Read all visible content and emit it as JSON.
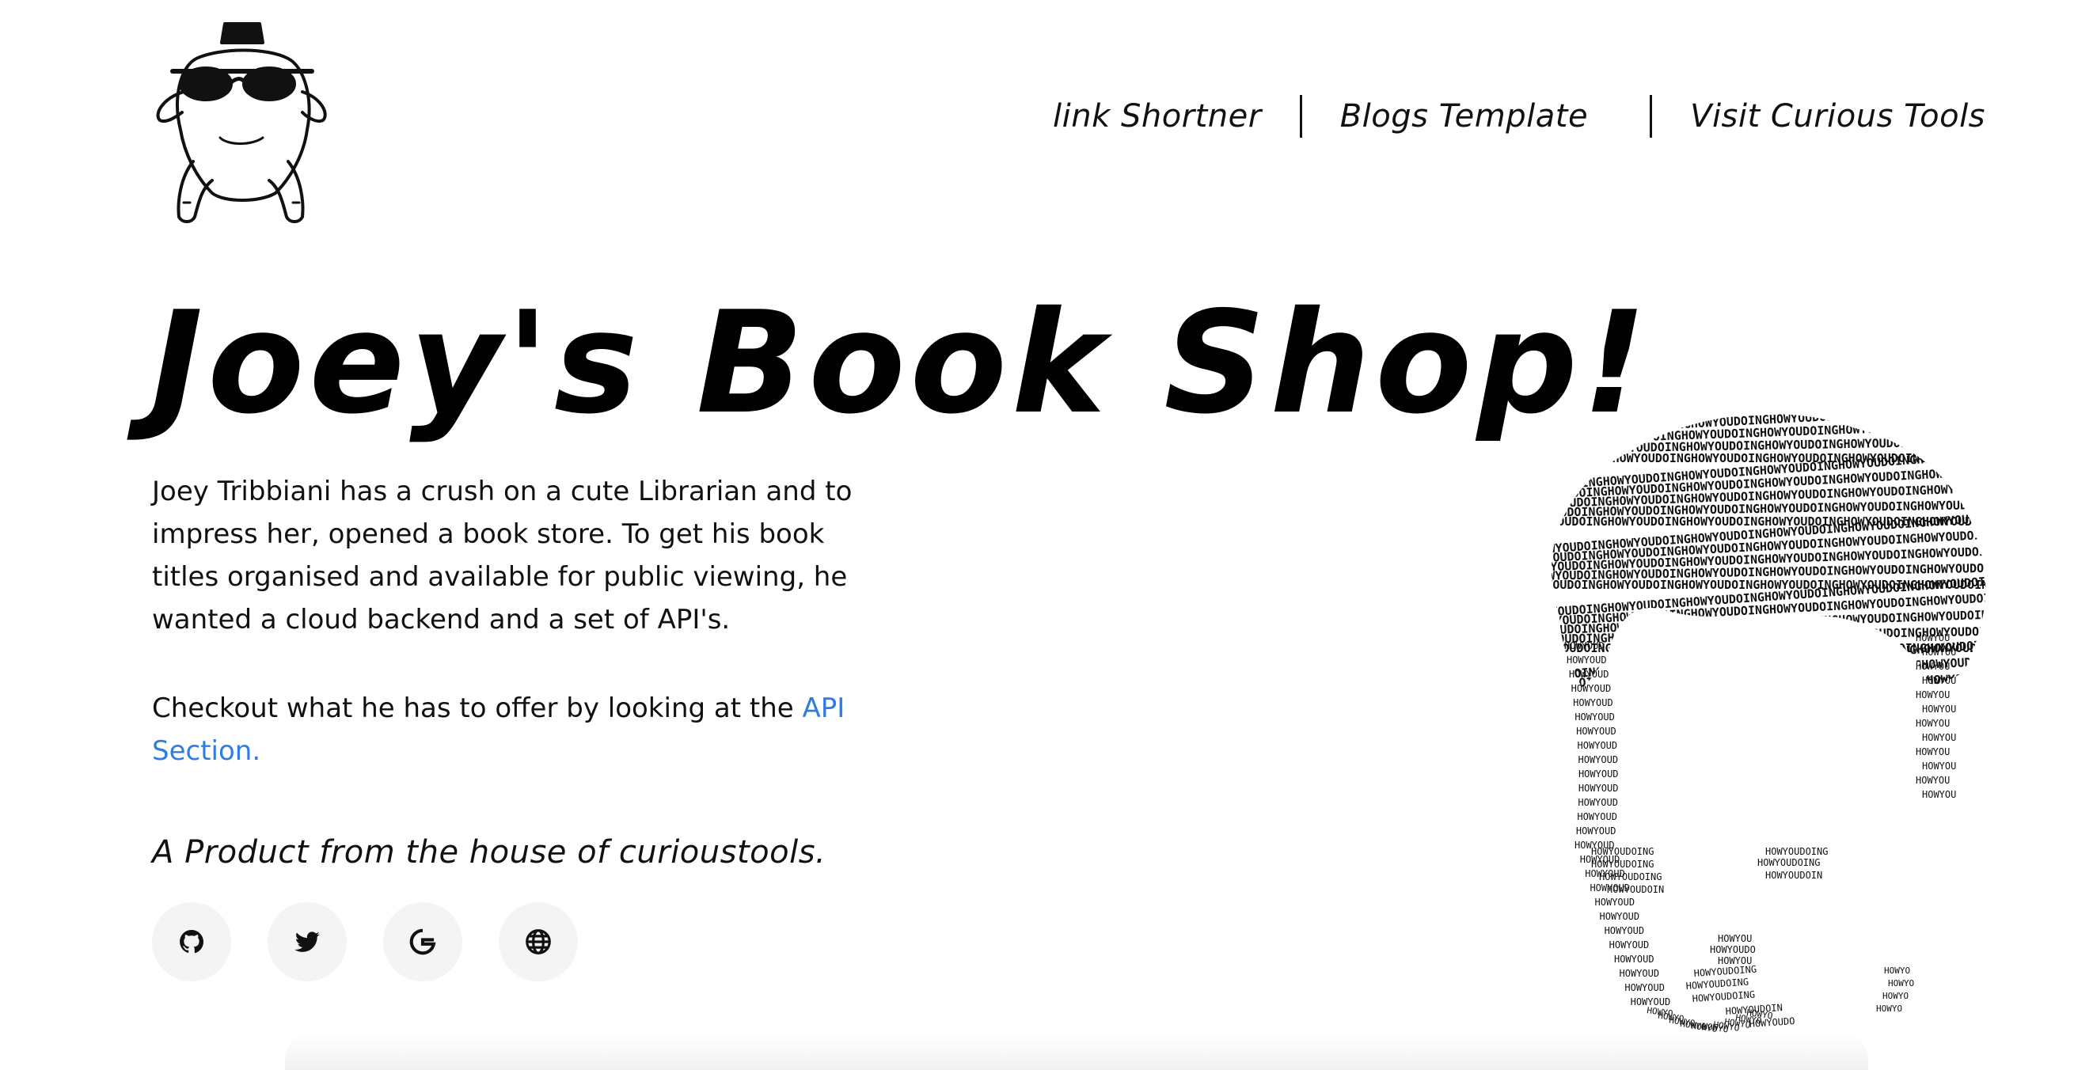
{
  "logo": {
    "alt": "joey-turkey-logo"
  },
  "nav": {
    "items": [
      {
        "label": "link Shortner"
      },
      {
        "label": "Blogs Template"
      },
      {
        "label": "Visit Curious Tools"
      }
    ]
  },
  "hero": {
    "title": "Joey's Book Shop!",
    "description": "Joey Tribbiani has a crush on a cute Librarian and to impress her, opened a book store. To get his book titles organised and available for public viewing, he wanted a cloud backend and a set of API's.",
    "checkout_text": "Checkout what he has to offer by looking at the ",
    "api_link": "API Section.",
    "tagline": "A Product from the house of curioustools."
  },
  "socials": [
    {
      "icon": "github-icon"
    },
    {
      "icon": "twitter-icon"
    },
    {
      "icon": "google-icon"
    },
    {
      "icon": "globe-icon"
    }
  ],
  "portrait": {
    "text": "HOW YOU DOING"
  },
  "colors": {
    "link": "#2f7de1",
    "text": "#111111",
    "social_bg": "#f4f4f4"
  }
}
